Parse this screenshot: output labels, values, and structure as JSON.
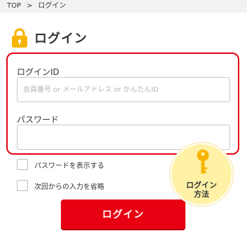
{
  "breadcrumb": {
    "home": "TOP",
    "separator": ">",
    "current": "ログイン"
  },
  "page": {
    "title": "ログイン",
    "title_icon": "lock-icon"
  },
  "form": {
    "login_id_label": "ログインID",
    "login_id_placeholder": "会員番号 or メールアドレス or かんたんID",
    "login_id_value": "",
    "password_label": "パスワード",
    "password_value": ""
  },
  "options": {
    "show_password_label": "パスワードを表示する",
    "remember_input_label": "次回からの入力を省略"
  },
  "login_button_label": "ログイン",
  "help": {
    "line1": "ログイン",
    "line2": "方法",
    "icon": "key-icon"
  },
  "colors": {
    "accent_red": "#e60012",
    "lock_yellow": "#f7b500",
    "help_bg": "#fff2a6"
  }
}
